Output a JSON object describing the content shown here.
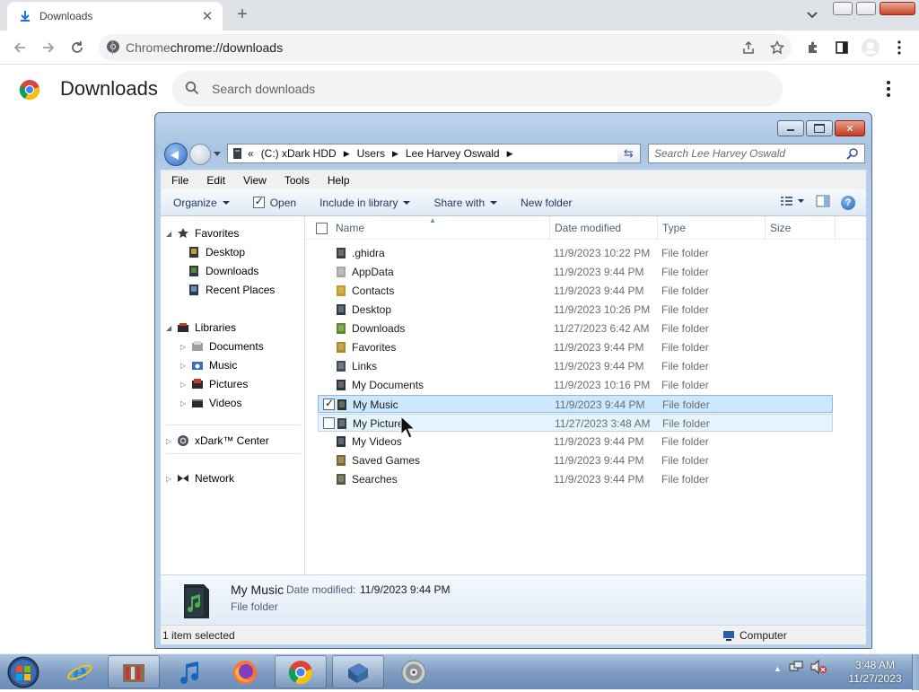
{
  "chrome": {
    "tab_title": "Downloads",
    "omnibox_site": "Chrome",
    "omnibox_url": "chrome://downloads"
  },
  "downloads_page": {
    "title": "Downloads",
    "search_placeholder": "Search downloads"
  },
  "explorer": {
    "breadcrumb": [
      "(C:) xDark HDD",
      "Users",
      "Lee Harvey Oswald"
    ],
    "breadcrumb_prefix": "«",
    "search_placeholder": "Search Lee Harvey Oswald",
    "menu": [
      "File",
      "Edit",
      "View",
      "Tools",
      "Help"
    ],
    "commands": {
      "organize": "Organize",
      "open": "Open",
      "include": "Include in library",
      "share": "Share with",
      "new_folder": "New folder"
    },
    "nav": {
      "favorites": "Favorites",
      "desktop": "Desktop",
      "downloads": "Downloads",
      "recent": "Recent Places",
      "libraries": "Libraries",
      "documents": "Documents",
      "music": "Music",
      "pictures": "Pictures",
      "videos": "Videos",
      "xdark": "xDark™ Center",
      "network": "Network"
    },
    "columns": {
      "name": "Name",
      "date": "Date modified",
      "type": "Type",
      "size": "Size"
    },
    "files": [
      {
        "name": ".ghidra",
        "date": "11/9/2023 10:22 PM",
        "type": "File folder",
        "color": "#3a3f46"
      },
      {
        "name": "AppData",
        "date": "11/9/2023 9:44 PM",
        "type": "File folder",
        "color": "#a7a7a7"
      },
      {
        "name": "Contacts",
        "date": "11/9/2023 9:44 PM",
        "type": "File folder",
        "color": "#c59a22"
      },
      {
        "name": "Desktop",
        "date": "11/9/2023 10:26 PM",
        "type": "File folder",
        "color": "#2f3a44"
      },
      {
        "name": "Downloads",
        "date": "11/27/2023 6:42 AM",
        "type": "File folder",
        "color": "#5b8a2e"
      },
      {
        "name": "Favorites",
        "date": "11/9/2023 9:44 PM",
        "type": "File folder",
        "color": "#b08a1c"
      },
      {
        "name": "Links",
        "date": "11/9/2023 9:44 PM",
        "type": "File folder",
        "color": "#444c55"
      },
      {
        "name": "My Documents",
        "date": "11/9/2023 10:16 PM",
        "type": "File folder",
        "color": "#2d3640"
      },
      {
        "name": "My Music",
        "date": "11/9/2023 9:44 PM",
        "type": "File folder",
        "color": "#2c3a2c"
      },
      {
        "name": "My Pictures",
        "date": "11/27/2023 3:48 AM",
        "type": "File folder",
        "color": "#3b3f47"
      },
      {
        "name": "My Videos",
        "date": "11/9/2023 9:44 PM",
        "type": "File folder",
        "color": "#2d3640"
      },
      {
        "name": "Saved Games",
        "date": "11/9/2023 9:44 PM",
        "type": "File folder",
        "color": "#7a6a2a"
      },
      {
        "name": "Searches",
        "date": "11/9/2023 9:44 PM",
        "type": "File folder",
        "color": "#5a5a3a"
      }
    ],
    "details": {
      "name": "My Music",
      "date_label": "Date modified:",
      "date_value": "11/9/2023 9:44 PM",
      "type": "File folder"
    },
    "status_left": "1 item selected",
    "status_right": "Computer"
  },
  "taskbar": {
    "time": "3:48 AM",
    "date": "11/27/2023"
  },
  "colors": {
    "chrome_tab_strip": "#dee1e6",
    "selection": "#cce8ff",
    "taskbar": "#7f9dc2"
  }
}
